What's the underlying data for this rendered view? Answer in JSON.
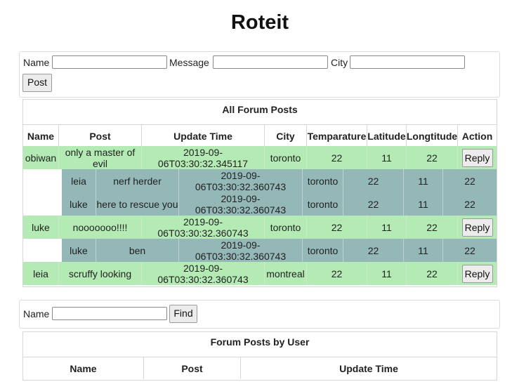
{
  "page_title": "Roteit",
  "post_form": {
    "name_label": "Name",
    "name_value": "",
    "message_label": "Message",
    "message_value": "",
    "city_label": "City",
    "city_value": "",
    "post_button": "Post"
  },
  "all_posts": {
    "title": "All Forum Posts",
    "headers": [
      "Name",
      "Post",
      "Update Time",
      "City",
      "Temparature",
      "Latitude",
      "Longtitude",
      "Action"
    ],
    "rows": [
      {
        "type": "post",
        "name": "obiwan",
        "post": "only a master of evil",
        "time": "2019-09-06T03:30:32.345117",
        "city": "toronto",
        "temp": "22",
        "lat": "11",
        "lon": "22",
        "action": "Reply"
      },
      {
        "type": "reply",
        "name": "leia",
        "post": "nerf herder",
        "time": "2019-09-06T03:30:32.360743",
        "city": "toronto",
        "temp": "22",
        "lat": "11",
        "lon": "22"
      },
      {
        "type": "reply",
        "name": "luke",
        "post": "here to rescue you",
        "time": "2019-09-06T03:30:32.360743",
        "city": "toronto",
        "temp": "22",
        "lat": "11",
        "lon": "22"
      },
      {
        "type": "post",
        "name": "luke",
        "post": "nooooooo!!!!",
        "time": "2019-09-06T03:30:32.360743",
        "city": "toronto",
        "temp": "22",
        "lat": "11",
        "lon": "22",
        "action": "Reply"
      },
      {
        "type": "reply",
        "name": "luke",
        "post": "ben",
        "time": "2019-09-06T03:30:32.360743",
        "city": "toronto",
        "temp": "22",
        "lat": "11",
        "lon": "22"
      },
      {
        "type": "post",
        "name": "leia",
        "post": "scruffy looking",
        "time": "2019-09-06T03:30:32.360743",
        "city": "montreal",
        "temp": "22",
        "lat": "11",
        "lon": "22",
        "action": "Reply"
      }
    ]
  },
  "find_form": {
    "name_label": "Name",
    "name_value": "",
    "find_button": "Find"
  },
  "user_posts": {
    "title": "Forum Posts by User",
    "headers": [
      "Name",
      "Post",
      "Update Time"
    ]
  },
  "colors": {
    "post_row": "#b4eab4",
    "reply_row": "#94b7b7"
  }
}
